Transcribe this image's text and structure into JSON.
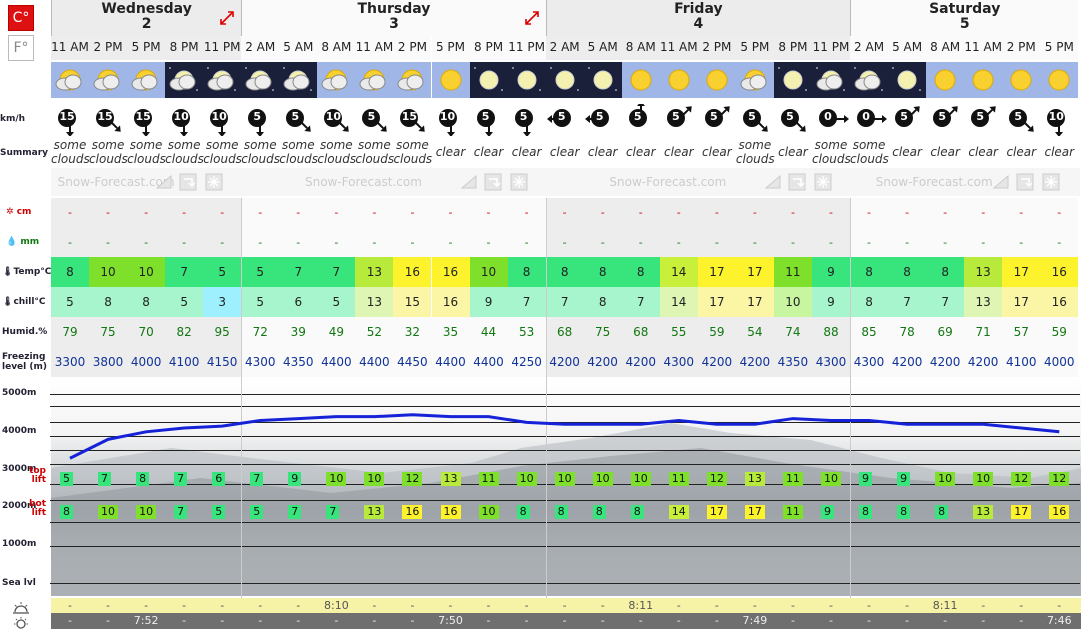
{
  "units": {
    "celsius": "C°",
    "fahrenheit": "F°"
  },
  "days": [
    {
      "name": "Wednesday",
      "num": "2",
      "start": 0,
      "count": 5
    },
    {
      "name": "Thursday",
      "num": "3",
      "start": 5,
      "count": 8
    },
    {
      "name": "Friday",
      "num": "4",
      "start": 13,
      "count": 8
    },
    {
      "name": "Saturday",
      "num": "5",
      "start": 21,
      "count": 6
    }
  ],
  "times": [
    "11 AM",
    "2 PM",
    "5 PM",
    "8 PM",
    "11 PM",
    "2 AM",
    "5 AM",
    "8 AM",
    "11 AM",
    "2 PM",
    "5 PM",
    "8 PM",
    "11 PM",
    "2 AM",
    "5 AM",
    "8 AM",
    "11 AM",
    "2 PM",
    "5 PM",
    "8 PM",
    "11 PM",
    "2 AM",
    "5 AM",
    "8 AM",
    "11 AM",
    "2 PM",
    "5 PM"
  ],
  "icons": [
    "sun-cloud",
    "sun-cloud",
    "sun-cloud",
    "moon-cloud",
    "moon-cloud",
    "moon-cloud",
    "moon-cloud",
    "sun-cloud",
    "sun-cloud",
    "sun-cloud",
    "sun",
    "moon",
    "moon",
    "moon",
    "moon",
    "sun",
    "sun",
    "sun",
    "sun-cloud",
    "moon",
    "moon-cloud",
    "moon-cloud",
    "moon",
    "sun",
    "sun",
    "sun",
    "sun"
  ],
  "row_labels": {
    "wind": "km/h",
    "summary": "Summary",
    "snow": "cm",
    "rain": "mm",
    "temp": "Temp°C",
    "chill": "chill°C",
    "humid": "Humid.%",
    "freezing": "Freezing level (m)",
    "top_lift": "top lift",
    "bot_lift": "bot lift",
    "sea": "Sea lvl"
  },
  "wind": [
    15,
    15,
    15,
    10,
    10,
    5,
    5,
    10,
    5,
    15,
    10,
    5,
    5,
    5,
    5,
    5,
    5,
    5,
    5,
    5,
    0,
    0,
    5,
    5,
    5,
    5,
    10
  ],
  "wind_dir": [
    "s",
    "se",
    "s",
    "s",
    "s",
    "s",
    "se",
    "se",
    "se",
    "se",
    "s",
    "s",
    "s",
    "w",
    "w",
    "n",
    "ne",
    "ne",
    "se",
    "se",
    "e",
    "e",
    "ne",
    "ne",
    "ne",
    "se",
    "s"
  ],
  "summary": [
    "some clouds",
    "some clouds",
    "some clouds",
    "some clouds",
    "some clouds",
    "some clouds",
    "some clouds",
    "some clouds",
    "some clouds",
    "some clouds",
    "clear",
    "clear",
    "clear",
    "clear",
    "clear",
    "clear",
    "clear",
    "clear",
    "some clouds",
    "clear",
    "some clouds",
    "some clouds",
    "clear",
    "clear",
    "clear",
    "clear",
    "clear"
  ],
  "brand": "Snow-Forecast.com",
  "snow": "-",
  "rain": "-",
  "temp": [
    8,
    10,
    10,
    7,
    5,
    5,
    7,
    7,
    13,
    16,
    16,
    10,
    8,
    8,
    8,
    8,
    14,
    17,
    17,
    11,
    9,
    8,
    8,
    8,
    13,
    17,
    16
  ],
  "chill": [
    5,
    8,
    8,
    5,
    3,
    5,
    6,
    5,
    13,
    15,
    16,
    9,
    7,
    7,
    8,
    7,
    14,
    17,
    17,
    10,
    9,
    8,
    7,
    7,
    13,
    17,
    16
  ],
  "humid": [
    79,
    75,
    70,
    82,
    95,
    72,
    39,
    49,
    52,
    32,
    35,
    44,
    53,
    68,
    75,
    68,
    55,
    59,
    54,
    74,
    88,
    85,
    78,
    69,
    71,
    57,
    59
  ],
  "freezing": [
    3300,
    3800,
    4000,
    4100,
    4150,
    4300,
    4350,
    4400,
    4400,
    4450,
    4400,
    4400,
    4250,
    4200,
    4200,
    4200,
    4300,
    4200,
    4200,
    4350,
    4300,
    4300,
    4200,
    4200,
    4200,
    4100,
    4000
  ],
  "altitude_labels": [
    "5000m",
    "4000m",
    "3000m",
    "2000m",
    "1000m"
  ],
  "top_lift": [
    5,
    7,
    8,
    7,
    6,
    7,
    9,
    10,
    10,
    12,
    13,
    11,
    10,
    10,
    10,
    10,
    11,
    12,
    13,
    11,
    10,
    9,
    9,
    10,
    10,
    12,
    12
  ],
  "bot_lift": [
    8,
    10,
    10,
    7,
    5,
    5,
    7,
    7,
    13,
    16,
    16,
    10,
    8,
    8,
    8,
    8,
    14,
    17,
    17,
    11,
    9,
    8,
    8,
    8,
    13,
    17,
    16
  ],
  "sunrise": [
    "8:10",
    "8:11",
    "8:11"
  ],
  "sunset": [
    "7:52",
    "7:50",
    "7:49",
    "7:46"
  ],
  "sun_dash": "-",
  "colors": {
    "accent": "#d11111",
    "freezing_line": "#1522d8"
  }
}
